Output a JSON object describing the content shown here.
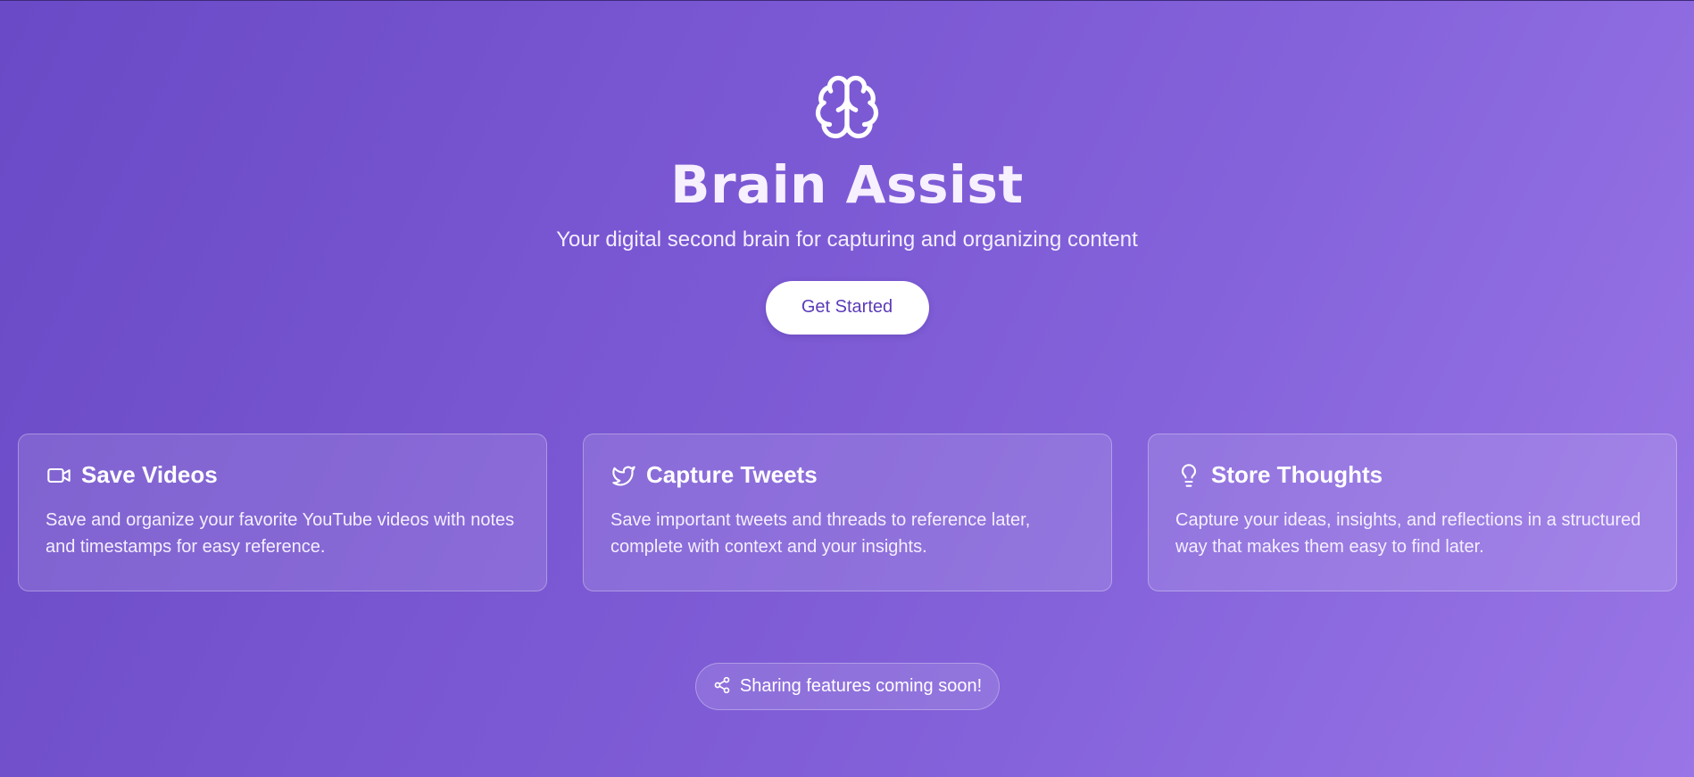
{
  "app": {
    "logo_icon": "brain-icon",
    "title": "Brain Assist",
    "subtitle": "Your digital second brain for capturing and organizing content",
    "cta_label": "Get Started"
  },
  "features": [
    {
      "icon": "video-camera-icon",
      "title": "Save Videos",
      "description": "Save and organize your favorite YouTube videos with notes and timestamps for easy reference."
    },
    {
      "icon": "twitter-bird-icon",
      "title": "Capture Tweets",
      "description": "Save important tweets and threads to reference later, complete with context and your insights."
    },
    {
      "icon": "lightbulb-icon",
      "title": "Store Thoughts",
      "description": "Capture your ideas, insights, and reflections in a structured way that makes them easy to find later."
    }
  ],
  "notice": {
    "icon": "share-icon",
    "text": "Sharing features coming soon!"
  },
  "colors": {
    "gradient_start": "#6a4ac6",
    "gradient_end": "#9975e6",
    "cta_text": "#5b3bb8",
    "cta_background": "#ffffff"
  }
}
